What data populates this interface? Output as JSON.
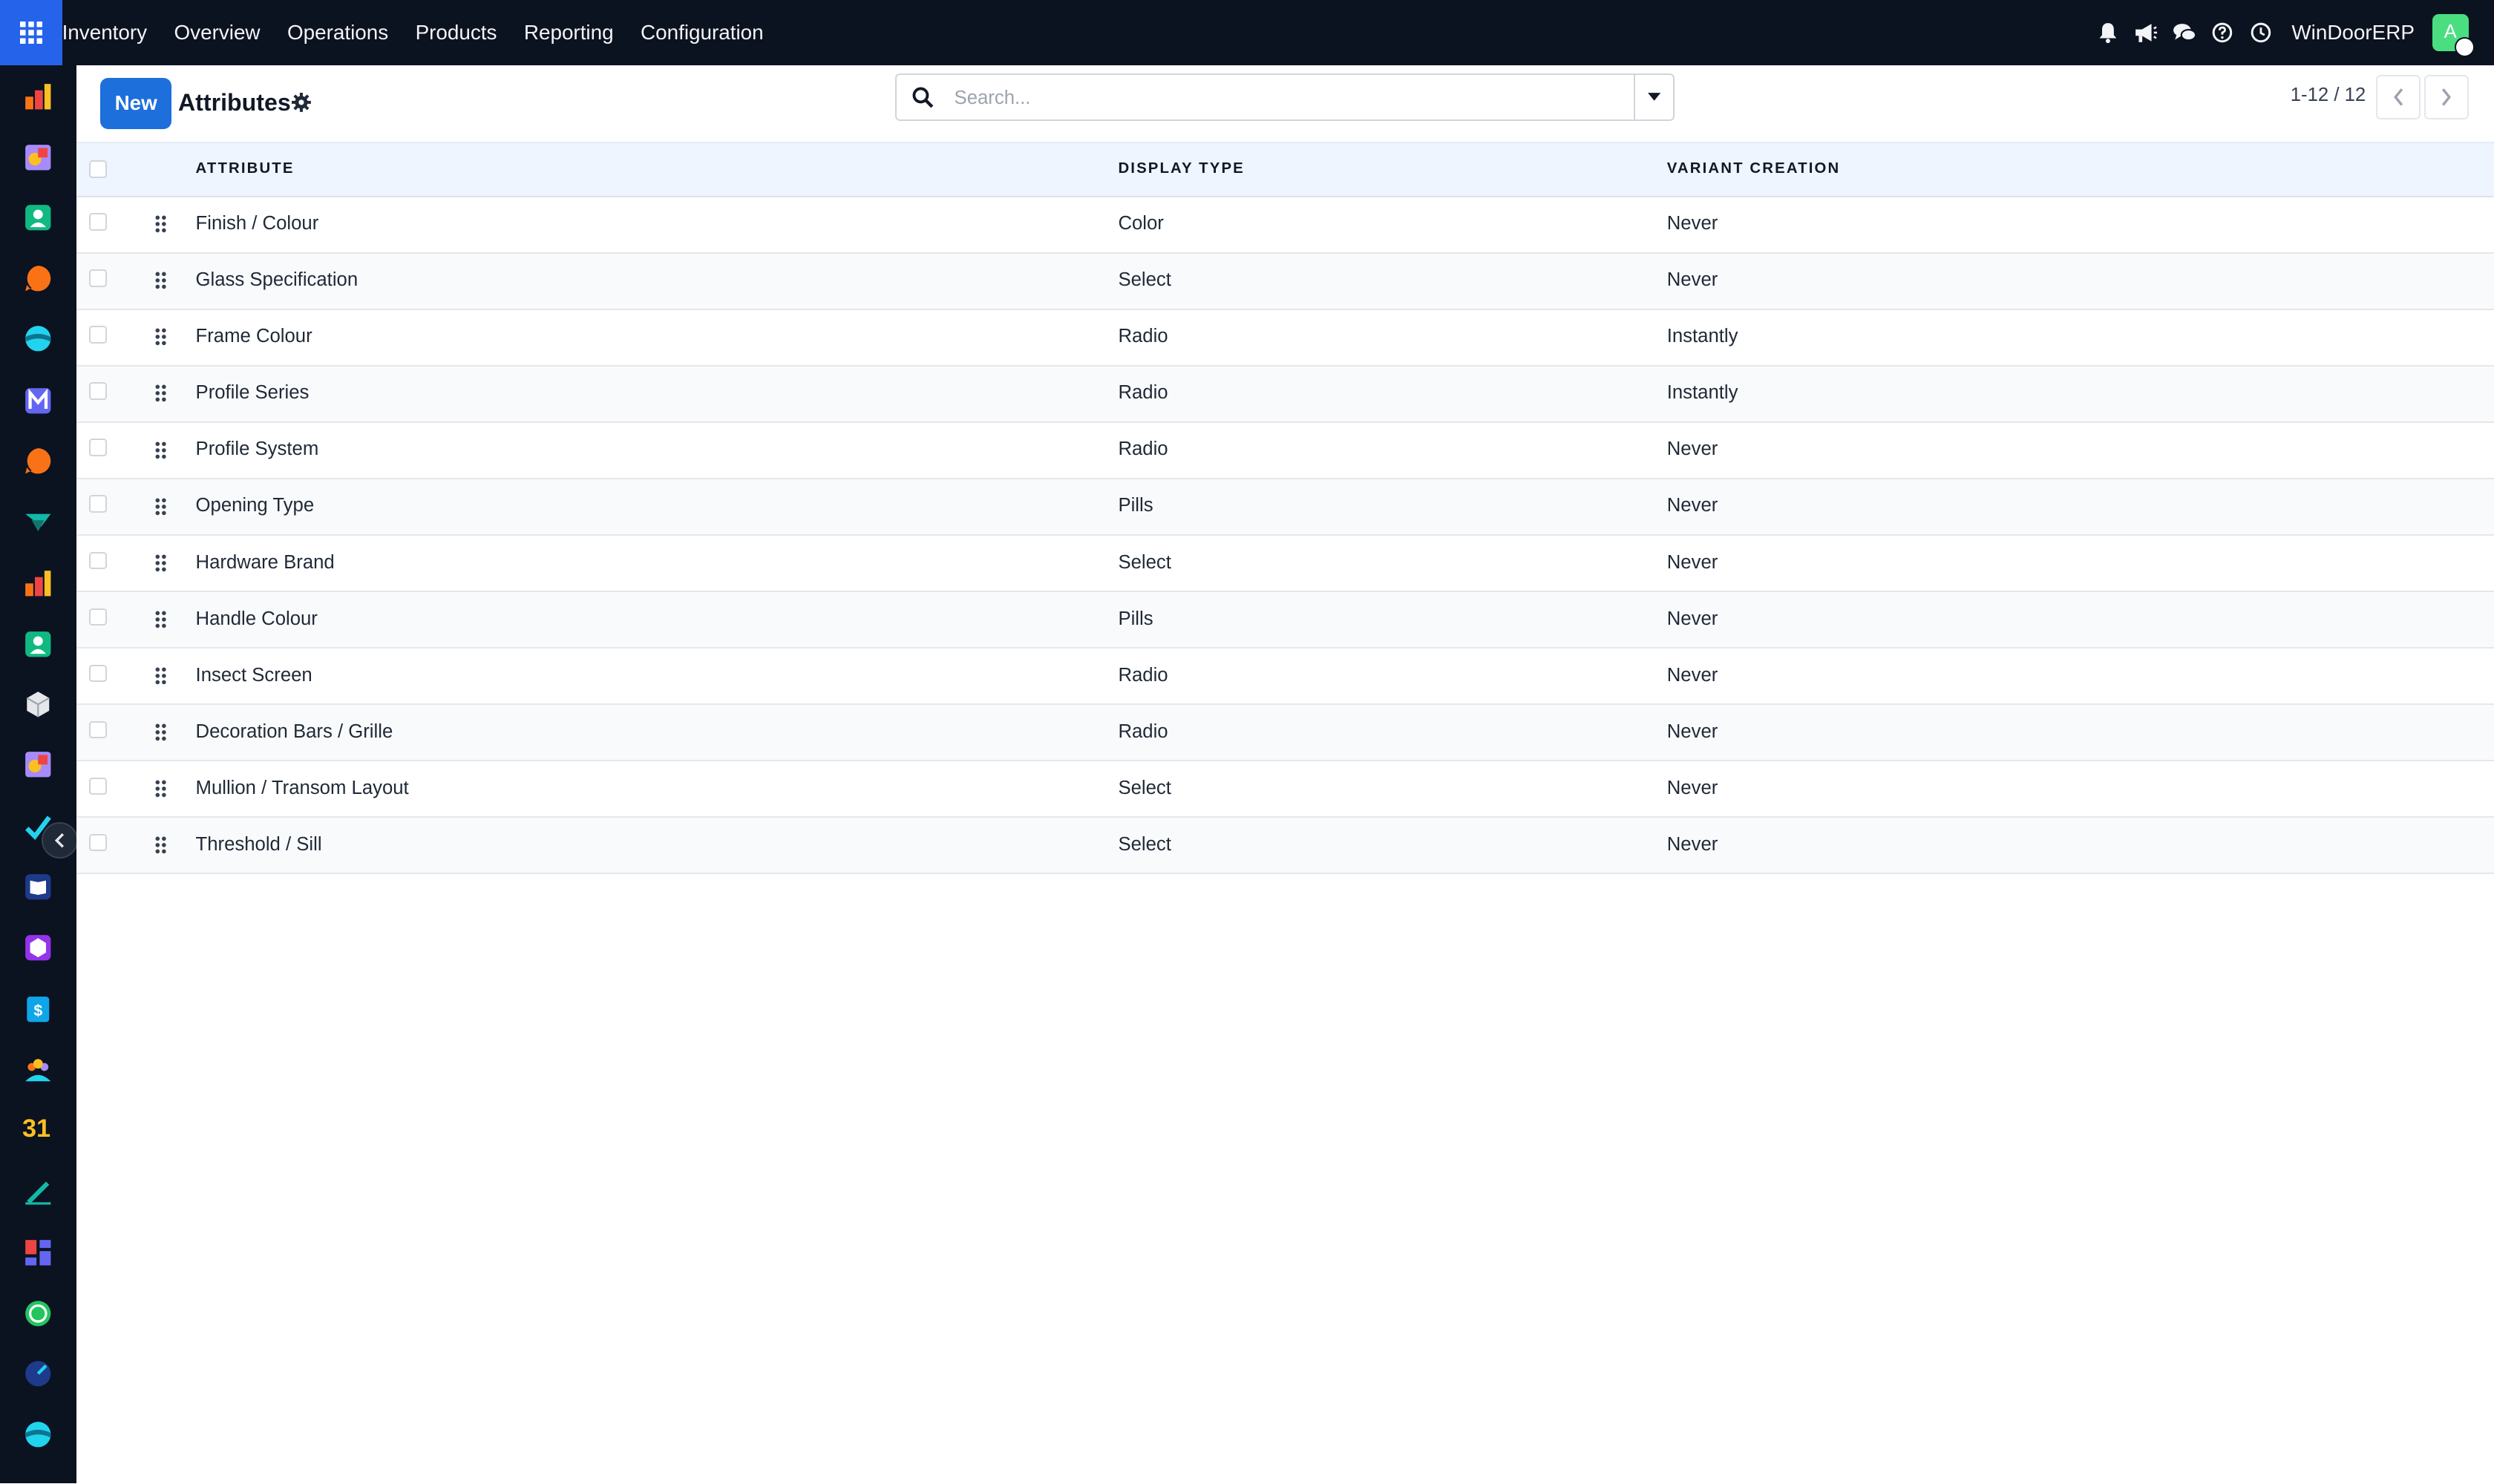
{
  "navbar": {
    "app_name": "Inventory",
    "menu": [
      "Overview",
      "Operations",
      "Products",
      "Reporting",
      "Configuration"
    ],
    "company": "WinDoorERP",
    "avatar_initial": "A",
    "icons": [
      "bell-icon",
      "megaphone-icon",
      "chat-icon",
      "help-icon",
      "clock-icon"
    ]
  },
  "control_panel": {
    "new_label": "New",
    "title": "Attributes",
    "search_placeholder": "Search...",
    "pager": "1-12 / 12"
  },
  "table": {
    "headers": [
      "ATTRIBUTE",
      "DISPLAY TYPE",
      "VARIANT CREATION"
    ],
    "rows": [
      {
        "attribute": "Finish / Colour",
        "display_type": "Color",
        "variant_creation": "Never"
      },
      {
        "attribute": "Glass Specification",
        "display_type": "Select",
        "variant_creation": "Never"
      },
      {
        "attribute": "Frame Colour",
        "display_type": "Radio",
        "variant_creation": "Instantly"
      },
      {
        "attribute": "Profile Series",
        "display_type": "Radio",
        "variant_creation": "Instantly"
      },
      {
        "attribute": "Profile System",
        "display_type": "Radio",
        "variant_creation": "Never"
      },
      {
        "attribute": "Opening Type",
        "display_type": "Pills",
        "variant_creation": "Never"
      },
      {
        "attribute": "Hardware Brand",
        "display_type": "Select",
        "variant_creation": "Never"
      },
      {
        "attribute": "Handle Colour",
        "display_type": "Pills",
        "variant_creation": "Never"
      },
      {
        "attribute": "Insect Screen",
        "display_type": "Radio",
        "variant_creation": "Never"
      },
      {
        "attribute": "Decoration Bars / Grille",
        "display_type": "Radio",
        "variant_creation": "Never"
      },
      {
        "attribute": "Mullion / Transom Layout",
        "display_type": "Select",
        "variant_creation": "Never"
      },
      {
        "attribute": "Threshold / Sill",
        "display_type": "Select",
        "variant_creation": "Never"
      }
    ]
  },
  "sidebar_apps": [
    "inventory-app-icon",
    "planning-app-icon",
    "contacts-app-icon",
    "discuss-app-icon",
    "website-app-icon",
    "email-app-icon",
    "live-chat-app-icon",
    "project-app-icon",
    "reporting-app-icon",
    "employees-app-icon",
    "products-app-icon",
    "repair-app-icon",
    "todo-app-icon",
    "knowledge-app-icon",
    "barcode-app-icon",
    "invoicing-app-icon",
    "team-app-icon",
    "calendar-app-icon",
    "sign-app-icon",
    "dashboards-app-icon",
    "whatsapp-app-icon",
    "timesheet-app-icon",
    "website-builder-app-icon"
  ],
  "calendar_day": "31",
  "colors": {
    "navbar_bg": "#0b1220",
    "accent": "#1d6fdc",
    "header_bg": "#eef5fe"
  }
}
